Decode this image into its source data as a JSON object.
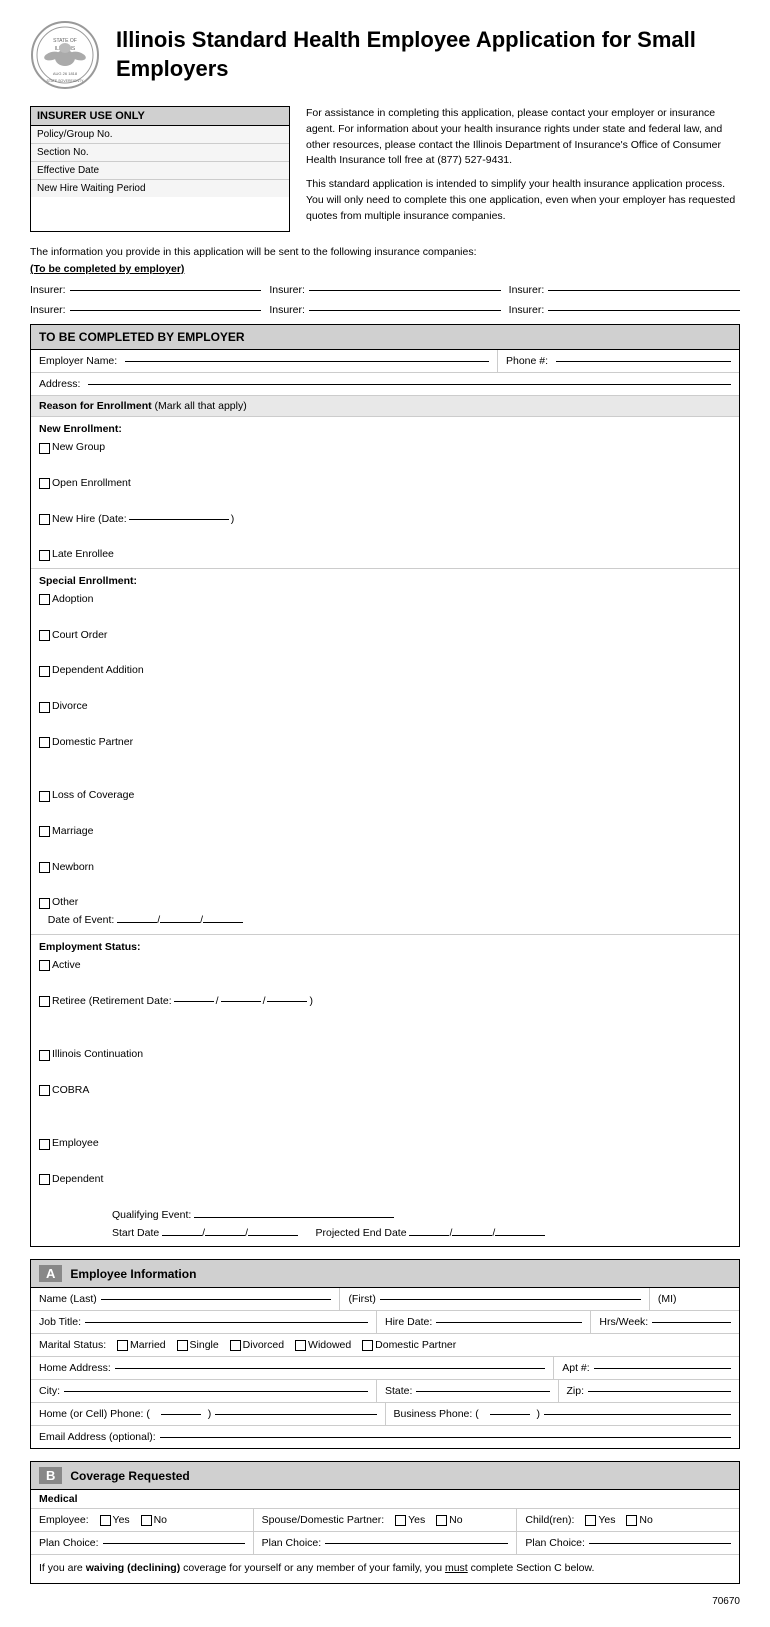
{
  "header": {
    "title": "Illinois Standard Health Employee Application for Small Employers"
  },
  "insurer_box": {
    "title": "INSURER USE ONLY",
    "fields": [
      "Policy/Group No.",
      "Section No.",
      "Effective Date",
      "New Hire Waiting Period"
    ]
  },
  "info_paragraphs": [
    "For assistance in completing this application, please contact your employer or insurance agent. For information about your health insurance rights under state and federal law, and other resources, please contact the Illinois Department of Insurance's Office of Consumer Health Insurance toll free at (877) 527-9431.",
    "This standard application is intended to simplify your health insurance application process. You will only need to complete this one application, even when your employer has requested quotes from multiple insurance companies."
  ],
  "companies_note": "The information you provide in this application will be sent to the following insurance companies:",
  "completed_by": "(To be completed by employer)",
  "insurer_labels": [
    "Insurer:",
    "Insurer:",
    "Insurer:",
    "Insurer:",
    "Insurer:",
    "Insurer:"
  ],
  "employer_section": {
    "title": "TO BE COMPLETED BY EMPLOYER",
    "employer_name_label": "Employer Name:",
    "phone_label": "Phone #:",
    "address_label": "Address:",
    "reason_header": "Reason for Enrollment",
    "reason_note": "(Mark all that apply)",
    "new_enrollment": {
      "label": "New Enrollment:",
      "options": [
        "New Group",
        "Open Enrollment",
        "New Hire (Date:",
        ")",
        "Late Enrollee"
      ]
    },
    "special_enrollment": {
      "label": "Special Enrollment:",
      "options": [
        "Adoption",
        "Court Order",
        "Dependent Addition",
        "Divorce",
        "Domestic Partner",
        "Loss of Coverage",
        "Marriage",
        "Newborn",
        "Other"
      ],
      "date_of_event": "Date of Event:"
    },
    "employment_status": {
      "label": "Employment Status:",
      "options": [
        "Active",
        "Retiree (Retirement Date:",
        "/",
        "/",
        ")",
        "Illinois Continuation",
        "COBRA",
        "Employee",
        "Dependent"
      ],
      "qualifying_event": "Qualifying Event:",
      "start_date": "Start Date",
      "projected_end": "Projected End Date"
    }
  },
  "section_a": {
    "badge": "A",
    "title": "Employee Information",
    "name_last": "Name (Last)",
    "name_first": "(First)",
    "name_mi": "(MI)",
    "job_title": "Job Title:",
    "hire_date": "Hire Date:",
    "hrs_week": "Hrs/Week:",
    "marital_status": "Marital Status:",
    "marital_options": [
      "Married",
      "Single",
      "Divorced",
      "Widowed",
      "Domestic Partner"
    ],
    "home_address": "Home Address:",
    "apt": "Apt #:",
    "city": "City:",
    "state": "State:",
    "zip": "Zip:",
    "home_phone": "Home (or Cell) Phone: (",
    "business_phone": "Business Phone: (",
    "email": "Email Address (optional):"
  },
  "section_b": {
    "badge": "B",
    "title": "Coverage Requested",
    "medical_label": "Medical",
    "employee_label": "Employee:",
    "employee_options": [
      "Yes",
      "No"
    ],
    "spouse_label": "Spouse/Domestic Partner:",
    "spouse_options": [
      "Yes",
      "No"
    ],
    "children_label": "Child(ren):",
    "children_options": [
      "Yes",
      "No"
    ],
    "plan_choice": "Plan Choice:",
    "waiving_text": "If you are waiving (declining) coverage for yourself or any member of your family, you must complete Section C below."
  },
  "page_number": "70670"
}
